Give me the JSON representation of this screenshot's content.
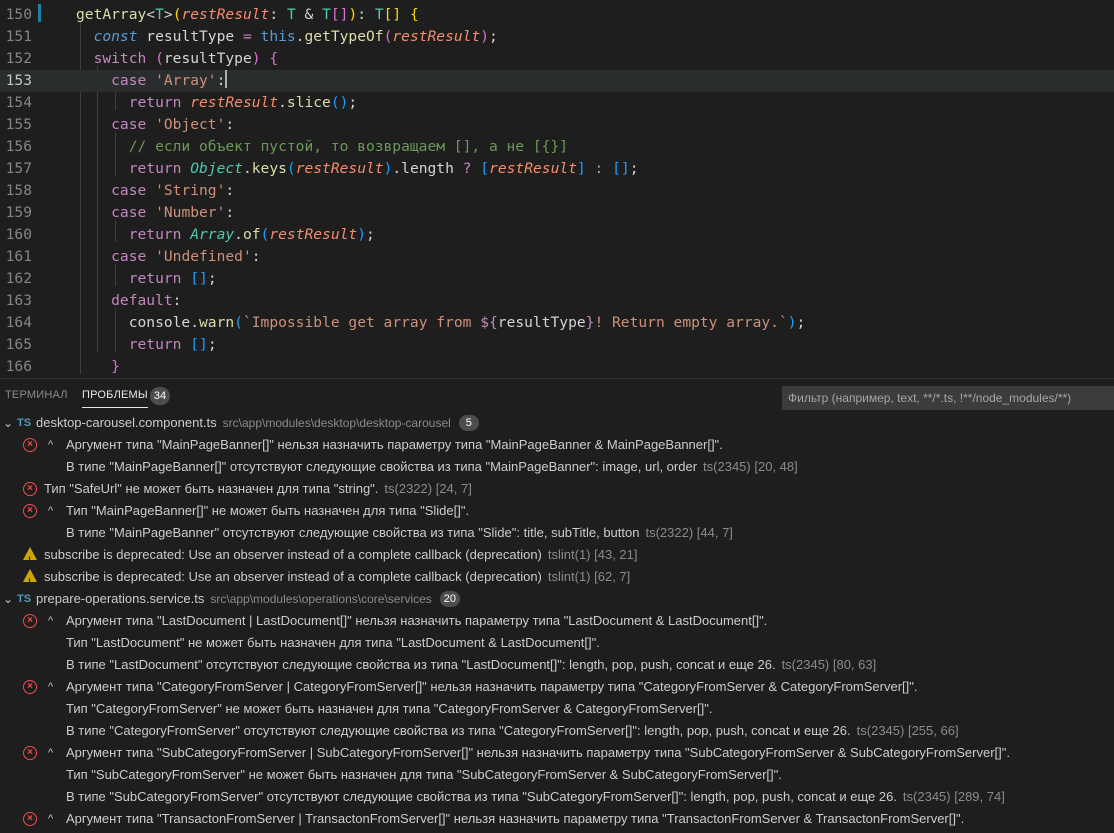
{
  "editor": {
    "lines": [
      {
        "n": "150",
        "parts": [
          [
            "t-fn",
            "getArray"
          ],
          [
            "t-punc",
            "<"
          ],
          [
            "t-type",
            "T"
          ],
          [
            "t-punc",
            ">"
          ],
          [
            "t-brk",
            "("
          ],
          [
            "t-param",
            "restResult"
          ],
          [
            "t-punc",
            ": "
          ],
          [
            "t-type",
            "T"
          ],
          [
            "t-punc",
            " & "
          ],
          [
            "t-type",
            "T"
          ],
          [
            "t-brk2",
            "[]"
          ],
          [
            "t-brk",
            ")"
          ],
          [
            "t-punc",
            ": "
          ],
          [
            "t-type",
            "T"
          ],
          [
            "t-brk",
            "[]"
          ],
          [
            "t-punc",
            " "
          ],
          [
            "t-brk",
            "{"
          ]
        ]
      },
      {
        "n": "151",
        "parts": [
          [
            "t-const",
            "  const"
          ],
          [
            "t-text",
            " resultType "
          ],
          [
            "t-op",
            "="
          ],
          [
            "t-text",
            " "
          ],
          [
            "t-this",
            "this"
          ],
          [
            "t-text",
            "."
          ],
          [
            "t-fn",
            "getTypeOf"
          ],
          [
            "t-brk2",
            "("
          ],
          [
            "t-param",
            "restResult"
          ],
          [
            "t-brk2",
            ")"
          ],
          [
            "t-text",
            ";"
          ]
        ]
      },
      {
        "n": "152",
        "parts": [
          [
            "t-ctrl",
            "  switch"
          ],
          [
            "t-text",
            " "
          ],
          [
            "t-brk2",
            "("
          ],
          [
            "t-text",
            "resultType"
          ],
          [
            "t-brk2",
            ")"
          ],
          [
            "t-text",
            " "
          ],
          [
            "t-brk2",
            "{"
          ]
        ]
      },
      {
        "n": "153",
        "current": true,
        "parts": [
          [
            "t-ctrl",
            "    case"
          ],
          [
            "t-text",
            " "
          ],
          [
            "t-str",
            "'Array'"
          ],
          [
            "t-text",
            ":"
          ],
          [
            "cursor",
            ""
          ]
        ]
      },
      {
        "n": "154",
        "parts": [
          [
            "t-ctrl",
            "      return"
          ],
          [
            "t-text",
            " "
          ],
          [
            "t-param",
            "restResult"
          ],
          [
            "t-text",
            "."
          ],
          [
            "t-fn",
            "slice"
          ],
          [
            "t-brk3",
            "()"
          ],
          [
            "t-text",
            ";"
          ]
        ]
      },
      {
        "n": "155",
        "parts": [
          [
            "t-ctrl",
            "    case"
          ],
          [
            "t-text",
            " "
          ],
          [
            "t-str",
            "'Object'"
          ],
          [
            "t-text",
            ":"
          ]
        ]
      },
      {
        "n": "156",
        "parts": [
          [
            "t-com",
            "      // если объект пустой, то возвращаем [], а не [{}]"
          ]
        ]
      },
      {
        "n": "157",
        "parts": [
          [
            "t-ctrl",
            "      return"
          ],
          [
            "t-text",
            " "
          ],
          [
            "t-obj",
            "Object"
          ],
          [
            "t-text",
            "."
          ],
          [
            "t-fn",
            "keys"
          ],
          [
            "t-brk3",
            "("
          ],
          [
            "t-param",
            "restResult"
          ],
          [
            "t-brk3",
            ")"
          ],
          [
            "t-text",
            ".length "
          ],
          [
            "t-op",
            "?"
          ],
          [
            "t-text",
            " "
          ],
          [
            "t-brk3",
            "["
          ],
          [
            "t-param",
            "restResult"
          ],
          [
            "t-brk3",
            "]"
          ],
          [
            "t-text",
            " "
          ],
          [
            "t-op",
            ":"
          ],
          [
            "t-text",
            " "
          ],
          [
            "t-brk3",
            "[]"
          ],
          [
            "t-text",
            ";"
          ]
        ]
      },
      {
        "n": "158",
        "parts": [
          [
            "t-ctrl",
            "    case"
          ],
          [
            "t-text",
            " "
          ],
          [
            "t-str",
            "'String'"
          ],
          [
            "t-text",
            ":"
          ]
        ]
      },
      {
        "n": "159",
        "parts": [
          [
            "t-ctrl",
            "    case"
          ],
          [
            "t-text",
            " "
          ],
          [
            "t-str",
            "'Number'"
          ],
          [
            "t-text",
            ":"
          ]
        ]
      },
      {
        "n": "160",
        "parts": [
          [
            "t-ctrl",
            "      return"
          ],
          [
            "t-text",
            " "
          ],
          [
            "t-obj",
            "Array"
          ],
          [
            "t-text",
            "."
          ],
          [
            "t-fn",
            "of"
          ],
          [
            "t-brk3",
            "("
          ],
          [
            "t-param",
            "restResult"
          ],
          [
            "t-brk3",
            ")"
          ],
          [
            "t-text",
            ";"
          ]
        ]
      },
      {
        "n": "161",
        "parts": [
          [
            "t-ctrl",
            "    case"
          ],
          [
            "t-text",
            " "
          ],
          [
            "t-str",
            "'Undefined'"
          ],
          [
            "t-text",
            ":"
          ]
        ]
      },
      {
        "n": "162",
        "parts": [
          [
            "t-ctrl",
            "      return"
          ],
          [
            "t-text",
            " "
          ],
          [
            "t-brk3",
            "[]"
          ],
          [
            "t-text",
            ";"
          ]
        ]
      },
      {
        "n": "163",
        "parts": [
          [
            "t-ctrl",
            "    default"
          ],
          [
            "t-text",
            ":"
          ]
        ]
      },
      {
        "n": "164",
        "parts": [
          [
            "t-text",
            "      console."
          ],
          [
            "t-fn",
            "warn"
          ],
          [
            "t-brk3",
            "("
          ],
          [
            "t-str",
            "`Impossible get array from "
          ],
          [
            "t-ctrl",
            "${"
          ],
          [
            "t-text",
            "resultType"
          ],
          [
            "t-ctrl",
            "}"
          ],
          [
            "t-str",
            "! Return empty array.`"
          ],
          [
            "t-brk3",
            ")"
          ],
          [
            "t-text",
            ";"
          ]
        ]
      },
      {
        "n": "165",
        "parts": [
          [
            "t-ctrl",
            "      return"
          ],
          [
            "t-text",
            " "
          ],
          [
            "t-brk3",
            "[]"
          ],
          [
            "t-text",
            ";"
          ]
        ]
      },
      {
        "n": "166",
        "parts": [
          [
            "t-brk2",
            "    }"
          ]
        ]
      }
    ]
  },
  "panel": {
    "tab_terminal": "ТЕРМИНАЛ",
    "tab_problems": "ПРОБЛЕМЫ",
    "problems_count": "34",
    "filter_placeholder": "Фильтр (например, text, **/*.ts, !**/node_modules/**)",
    "file1": {
      "name": "desktop-carousel.component.ts",
      "path": "src\\app\\modules\\desktop\\desktop-carousel",
      "count": "5"
    },
    "file2": {
      "name": "prepare-operations.service.ts",
      "path": "src\\app\\modules\\operations\\core\\services",
      "count": "20"
    },
    "rows": [
      {
        "type": "file",
        "file": "file1"
      },
      {
        "type": "error",
        "expand": true,
        "text": "Аргумент типа \"MainPageBanner[]\" нельзя назначить параметру типа \"MainPageBanner & MainPageBanner[]\".",
        "src": ""
      },
      {
        "type": "cont",
        "text": "В типе \"MainPageBanner[]\" отсутствуют следующие свойства из типа \"MainPageBanner\": image, url, order",
        "src": "ts(2345)  [20, 48]"
      },
      {
        "type": "error",
        "expand": false,
        "text": "Тип \"SafeUrl\" не может быть назначен для типа \"string\".",
        "src": "ts(2322)  [24, 7]"
      },
      {
        "type": "error",
        "expand": true,
        "text": "Тип \"MainPageBanner[]\" не может быть назначен для типа \"Slide[]\".",
        "src": ""
      },
      {
        "type": "cont",
        "text": "В типе \"MainPageBanner\" отсутствуют следующие свойства из типа \"Slide\": title, subTitle, button",
        "src": "ts(2322)  [44, 7]"
      },
      {
        "type": "warn",
        "text": "subscribe is deprecated: Use an observer instead of a complete callback (deprecation)",
        "src": "tslint(1)  [43, 21]"
      },
      {
        "type": "warn",
        "text": "subscribe is deprecated: Use an observer instead of a complete callback (deprecation)",
        "src": "tslint(1)  [62, 7]"
      },
      {
        "type": "file",
        "file": "file2"
      },
      {
        "type": "error",
        "expand": true,
        "text": "Аргумент типа \"LastDocument | LastDocument[]\" нельзя назначить параметру типа \"LastDocument & LastDocument[]\".",
        "src": ""
      },
      {
        "type": "cont",
        "text": "Тип \"LastDocument\" не может быть назначен для типа \"LastDocument & LastDocument[]\".",
        "src": ""
      },
      {
        "type": "cont",
        "text": "В типе \"LastDocument\" отсутствуют следующие свойства из типа \"LastDocument[]\": length, pop, push, concat и еще 26.",
        "src": "ts(2345)  [80, 63]"
      },
      {
        "type": "error",
        "expand": true,
        "text": "Аргумент типа \"CategoryFromServer | CategoryFromServer[]\" нельзя назначить параметру типа \"CategoryFromServer & CategoryFromServer[]\".",
        "src": ""
      },
      {
        "type": "cont",
        "text": "Тип \"CategoryFromServer\" не может быть назначен для типа \"CategoryFromServer & CategoryFromServer[]\".",
        "src": ""
      },
      {
        "type": "cont",
        "text": "В типе \"CategoryFromServer\" отсутствуют следующие свойства из типа \"CategoryFromServer[]\": length, pop, push, concat и еще 26.",
        "src": "ts(2345)  [255, 66]"
      },
      {
        "type": "error",
        "expand": true,
        "text": "Аргумент типа \"SubCategoryFromServer | SubCategoryFromServer[]\" нельзя назначить параметру типа \"SubCategoryFromServer & SubCategoryFromServer[]\".",
        "src": ""
      },
      {
        "type": "cont",
        "text": "Тип \"SubCategoryFromServer\" не может быть назначен для типа \"SubCategoryFromServer & SubCategoryFromServer[]\".",
        "src": ""
      },
      {
        "type": "cont",
        "text": "В типе \"SubCategoryFromServer\" отсутствуют следующие свойства из типа \"SubCategoryFromServer[]\": length, pop, push, concat и еще 26.",
        "src": "ts(2345)  [289, 74]"
      },
      {
        "type": "error",
        "expand": true,
        "text": "Аргумент типа \"TransactonFromServer | TransactonFromServer[]\" нельзя назначить параметру типа \"TransactonFromServer & TransactonFromServer[]\".",
        "src": ""
      }
    ]
  }
}
